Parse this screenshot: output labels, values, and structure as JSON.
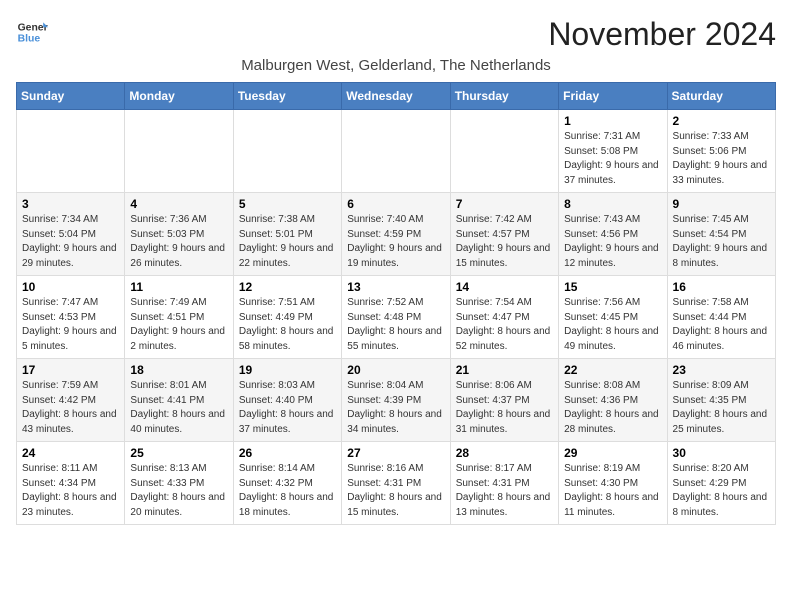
{
  "header": {
    "logo_line1": "General",
    "logo_line2": "Blue",
    "month_title": "November 2024",
    "location": "Malburgen West, Gelderland, The Netherlands"
  },
  "weekdays": [
    "Sunday",
    "Monday",
    "Tuesday",
    "Wednesday",
    "Thursday",
    "Friday",
    "Saturday"
  ],
  "weeks": [
    [
      {
        "day": "",
        "info": ""
      },
      {
        "day": "",
        "info": ""
      },
      {
        "day": "",
        "info": ""
      },
      {
        "day": "",
        "info": ""
      },
      {
        "day": "",
        "info": ""
      },
      {
        "day": "1",
        "info": "Sunrise: 7:31 AM\nSunset: 5:08 PM\nDaylight: 9 hours and 37 minutes."
      },
      {
        "day": "2",
        "info": "Sunrise: 7:33 AM\nSunset: 5:06 PM\nDaylight: 9 hours and 33 minutes."
      }
    ],
    [
      {
        "day": "3",
        "info": "Sunrise: 7:34 AM\nSunset: 5:04 PM\nDaylight: 9 hours and 29 minutes."
      },
      {
        "day": "4",
        "info": "Sunrise: 7:36 AM\nSunset: 5:03 PM\nDaylight: 9 hours and 26 minutes."
      },
      {
        "day": "5",
        "info": "Sunrise: 7:38 AM\nSunset: 5:01 PM\nDaylight: 9 hours and 22 minutes."
      },
      {
        "day": "6",
        "info": "Sunrise: 7:40 AM\nSunset: 4:59 PM\nDaylight: 9 hours and 19 minutes."
      },
      {
        "day": "7",
        "info": "Sunrise: 7:42 AM\nSunset: 4:57 PM\nDaylight: 9 hours and 15 minutes."
      },
      {
        "day": "8",
        "info": "Sunrise: 7:43 AM\nSunset: 4:56 PM\nDaylight: 9 hours and 12 minutes."
      },
      {
        "day": "9",
        "info": "Sunrise: 7:45 AM\nSunset: 4:54 PM\nDaylight: 9 hours and 8 minutes."
      }
    ],
    [
      {
        "day": "10",
        "info": "Sunrise: 7:47 AM\nSunset: 4:53 PM\nDaylight: 9 hours and 5 minutes."
      },
      {
        "day": "11",
        "info": "Sunrise: 7:49 AM\nSunset: 4:51 PM\nDaylight: 9 hours and 2 minutes."
      },
      {
        "day": "12",
        "info": "Sunrise: 7:51 AM\nSunset: 4:49 PM\nDaylight: 8 hours and 58 minutes."
      },
      {
        "day": "13",
        "info": "Sunrise: 7:52 AM\nSunset: 4:48 PM\nDaylight: 8 hours and 55 minutes."
      },
      {
        "day": "14",
        "info": "Sunrise: 7:54 AM\nSunset: 4:47 PM\nDaylight: 8 hours and 52 minutes."
      },
      {
        "day": "15",
        "info": "Sunrise: 7:56 AM\nSunset: 4:45 PM\nDaylight: 8 hours and 49 minutes."
      },
      {
        "day": "16",
        "info": "Sunrise: 7:58 AM\nSunset: 4:44 PM\nDaylight: 8 hours and 46 minutes."
      }
    ],
    [
      {
        "day": "17",
        "info": "Sunrise: 7:59 AM\nSunset: 4:42 PM\nDaylight: 8 hours and 43 minutes."
      },
      {
        "day": "18",
        "info": "Sunrise: 8:01 AM\nSunset: 4:41 PM\nDaylight: 8 hours and 40 minutes."
      },
      {
        "day": "19",
        "info": "Sunrise: 8:03 AM\nSunset: 4:40 PM\nDaylight: 8 hours and 37 minutes."
      },
      {
        "day": "20",
        "info": "Sunrise: 8:04 AM\nSunset: 4:39 PM\nDaylight: 8 hours and 34 minutes."
      },
      {
        "day": "21",
        "info": "Sunrise: 8:06 AM\nSunset: 4:37 PM\nDaylight: 8 hours and 31 minutes."
      },
      {
        "day": "22",
        "info": "Sunrise: 8:08 AM\nSunset: 4:36 PM\nDaylight: 8 hours and 28 minutes."
      },
      {
        "day": "23",
        "info": "Sunrise: 8:09 AM\nSunset: 4:35 PM\nDaylight: 8 hours and 25 minutes."
      }
    ],
    [
      {
        "day": "24",
        "info": "Sunrise: 8:11 AM\nSunset: 4:34 PM\nDaylight: 8 hours and 23 minutes."
      },
      {
        "day": "25",
        "info": "Sunrise: 8:13 AM\nSunset: 4:33 PM\nDaylight: 8 hours and 20 minutes."
      },
      {
        "day": "26",
        "info": "Sunrise: 8:14 AM\nSunset: 4:32 PM\nDaylight: 8 hours and 18 minutes."
      },
      {
        "day": "27",
        "info": "Sunrise: 8:16 AM\nSunset: 4:31 PM\nDaylight: 8 hours and 15 minutes."
      },
      {
        "day": "28",
        "info": "Sunrise: 8:17 AM\nSunset: 4:31 PM\nDaylight: 8 hours and 13 minutes."
      },
      {
        "day": "29",
        "info": "Sunrise: 8:19 AM\nSunset: 4:30 PM\nDaylight: 8 hours and 11 minutes."
      },
      {
        "day": "30",
        "info": "Sunrise: 8:20 AM\nSunset: 4:29 PM\nDaylight: 8 hours and 8 minutes."
      }
    ]
  ]
}
